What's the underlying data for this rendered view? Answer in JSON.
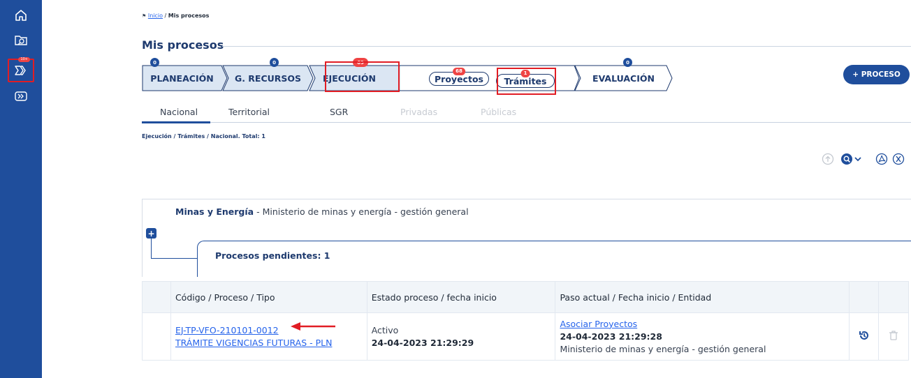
{
  "sidebar": {
    "items": [
      {
        "icon": "home-icon"
      },
      {
        "icon": "search-folder-icon"
      },
      {
        "icon": "process-icon",
        "badge": "10+"
      },
      {
        "icon": "process-alt-icon"
      }
    ]
  },
  "breadcrumb": {
    "home_icon": "home-icon",
    "home_label": "Inicio",
    "separator": "/",
    "current": "Mis procesos"
  },
  "page": {
    "title": "Mis procesos",
    "new_button": "+ PROCESO"
  },
  "stepper": {
    "steps": [
      {
        "label": "PLANEACIÓN",
        "count": "0"
      },
      {
        "label": "G. RECURSOS",
        "count": "0"
      },
      {
        "label": "EJECUCIÓN",
        "count": "69"
      },
      {
        "label": "EVALUACIÓN",
        "count": "0"
      }
    ],
    "sub": [
      {
        "label": "Proyectos",
        "count": "68"
      },
      {
        "label": "Trámites",
        "count": "1"
      }
    ]
  },
  "tabs": [
    {
      "label": "Nacional",
      "active": true
    },
    {
      "label": "Territorial"
    },
    {
      "label": "SGR"
    },
    {
      "label": "Privadas",
      "disabled": true
    },
    {
      "label": "Públicas",
      "disabled": true
    }
  ],
  "summary": "Ejecución / Trámites / Nacional. Total: 1",
  "tools": [
    "upload-icon",
    "search-filter-icon",
    "pdf-icon",
    "excel-icon"
  ],
  "group": {
    "sector": "Minas y Energía",
    "sep": " - ",
    "entity": "Ministerio de minas y energía - gestión general",
    "pending_label": "Procesos pendientes: 1"
  },
  "table": {
    "headers": [
      "Código / Proceso / Tipo",
      "Estado proceso / fecha inicio",
      "Paso actual / Fecha inicio / Entidad"
    ],
    "rows": [
      {
        "code": "EJ-TP-VFO-210101-0012",
        "process": "TRÁMITE VIGENCIAS FUTURAS - PLN",
        "status": "Activo",
        "start": "24-04-2023 21:29:29",
        "step": "Asociar Proyectos",
        "step_date": "24-04-2023 21:29:28",
        "entity": "Ministerio de minas y energía - gestión general"
      }
    ]
  },
  "colors": {
    "sidebar": "#1f4e9c",
    "accent": "#1e3a6e",
    "highlight": "#e11d24",
    "badge": "#ef4444"
  }
}
